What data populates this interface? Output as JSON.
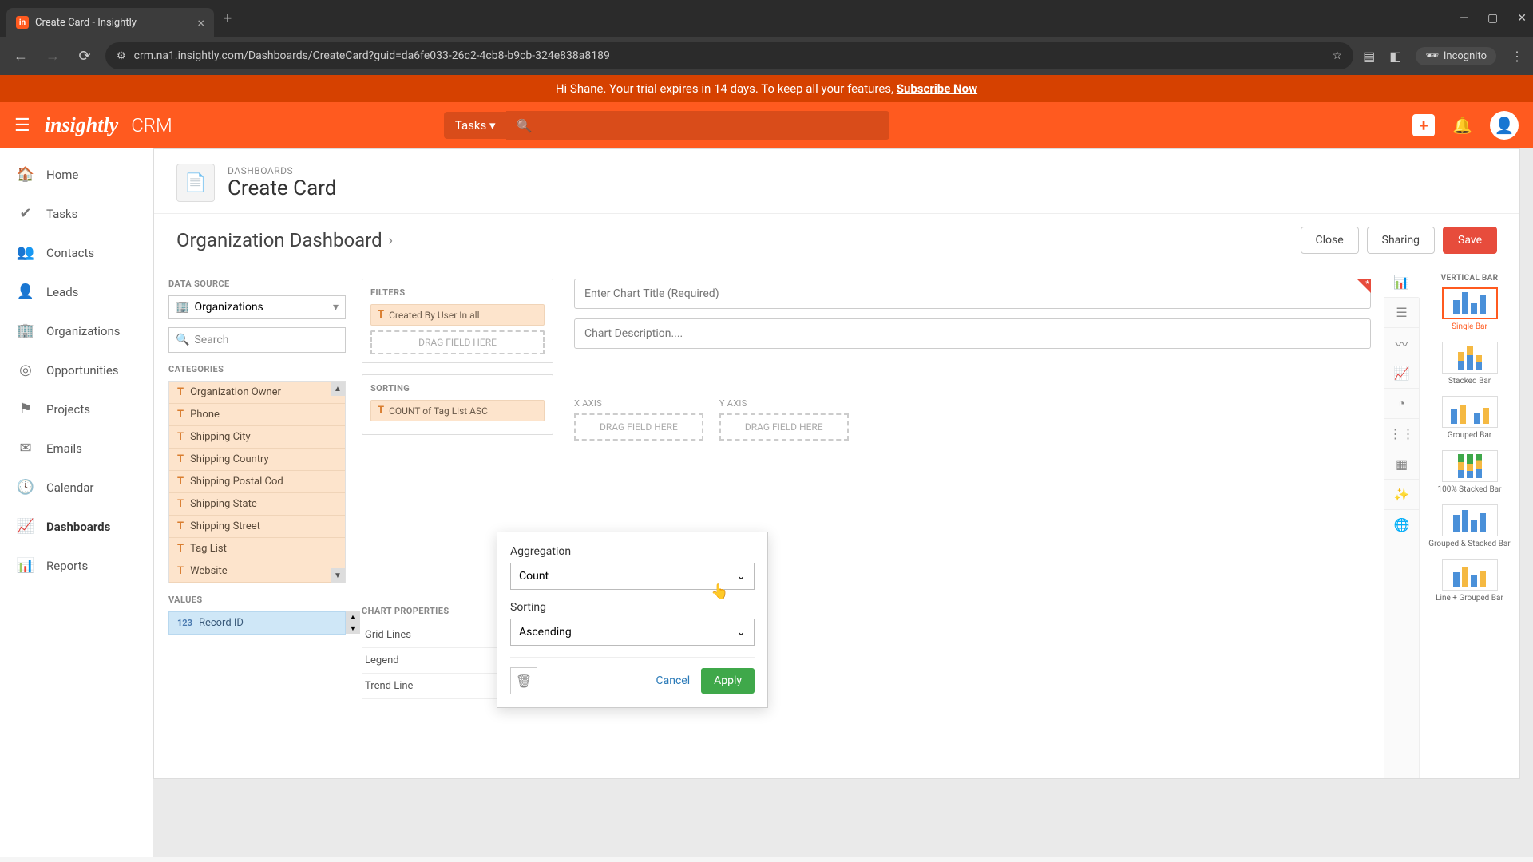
{
  "browser": {
    "tab_title": "Create Card - Insightly",
    "url": "crm.na1.insightly.com/Dashboards/CreateCard?guid=da6fe033-26c2-4cb8-b9cb-324e838a8189",
    "incognito_label": "Incognito"
  },
  "trial_banner": {
    "prefix": "Hi Shane. Your trial expires in 14 days. To keep all your features, ",
    "link": "Subscribe Now"
  },
  "app_header": {
    "logo": "insightly",
    "app_name": "CRM",
    "tasks_label": "Tasks"
  },
  "sidebar": {
    "items": [
      {
        "label": "Home",
        "icon": "🏠"
      },
      {
        "label": "Tasks",
        "icon": "✔"
      },
      {
        "label": "Contacts",
        "icon": "👥"
      },
      {
        "label": "Leads",
        "icon": "👤"
      },
      {
        "label": "Organizations",
        "icon": "🏢"
      },
      {
        "label": "Opportunities",
        "icon": "◎"
      },
      {
        "label": "Projects",
        "icon": "⚑"
      },
      {
        "label": "Emails",
        "icon": "✉"
      },
      {
        "label": "Calendar",
        "icon": "🕓"
      },
      {
        "label": "Dashboards",
        "icon": "📈"
      },
      {
        "label": "Reports",
        "icon": "📊"
      }
    ]
  },
  "page": {
    "breadcrumb": "DASHBOARDS",
    "title": "Create Card",
    "dashboard_name": "Organization Dashboard",
    "close": "Close",
    "sharing": "Sharing",
    "save": "Save"
  },
  "datasource": {
    "label": "DATA SOURCE",
    "value": "Organizations",
    "search_placeholder": "Search"
  },
  "categories": {
    "label": "CATEGORIES",
    "items": [
      "Organization Owner",
      "Phone",
      "Shipping City",
      "Shipping Country",
      "Shipping Postal Cod",
      "Shipping State",
      "Shipping Street",
      "Tag List",
      "Website"
    ]
  },
  "values_section": {
    "label": "VALUES",
    "item": "Record ID"
  },
  "filters": {
    "label": "FILTERS",
    "chip": "Created By User In all",
    "drag_hint": "DRAG FIELD HERE"
  },
  "sorting": {
    "label": "SORTING",
    "chip": "COUNT of Tag List ASC"
  },
  "chart_props": {
    "label": "CHART PROPERTIES",
    "items": [
      "Grid Lines",
      "Legend",
      "Trend Line"
    ]
  },
  "chart_inputs": {
    "title_placeholder": "Enter Chart Title (Required)",
    "desc_placeholder": "Chart Description....",
    "x_label": "X AXIS",
    "y_label": "Y AXIS",
    "drag_hint": "DRAG FIELD HERE"
  },
  "chart_types": {
    "header": "VERTICAL BAR",
    "items": [
      "Single Bar",
      "Stacked Bar",
      "Grouped Bar",
      "100% Stacked Bar",
      "Grouped & Stacked Bar",
      "Line + Grouped Bar"
    ]
  },
  "popup": {
    "agg_label": "Aggregation",
    "agg_value": "Count",
    "sort_label": "Sorting",
    "sort_value": "Ascending",
    "cancel": "Cancel",
    "apply": "Apply"
  }
}
